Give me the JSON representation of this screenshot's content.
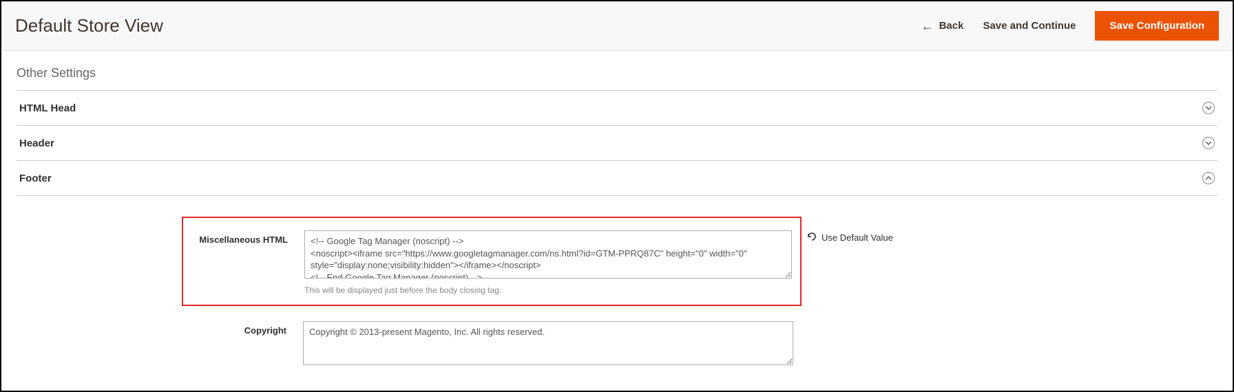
{
  "header": {
    "title": "Default Store View",
    "back_label": "Back",
    "save_continue_label": "Save and Continue",
    "save_config_label": "Save Configuration"
  },
  "section_header": "Other Settings",
  "accordions": {
    "html_head": "HTML Head",
    "header": "Header",
    "footer": "Footer"
  },
  "footer_panel": {
    "misc_label": "Miscellaneous HTML",
    "misc_value": "<!-- Google Tag Manager (noscript) -->\n<noscript><iframe src=\"https://www.googletagmanager.com/ns.html?id=GTM-PPRQ87C\" height=\"0\" width=\"0\" style=\"display:none;visibility:hidden\"></iframe></noscript>\n<!-- End Google Tag Manager (noscript) -->",
    "misc_helper": "This will be displayed just before the body closing tag.",
    "use_default_label": "Use Default Value",
    "copyright_label": "Copyright",
    "copyright_value": "Copyright © 2013-present Magento, Inc. All rights reserved."
  }
}
